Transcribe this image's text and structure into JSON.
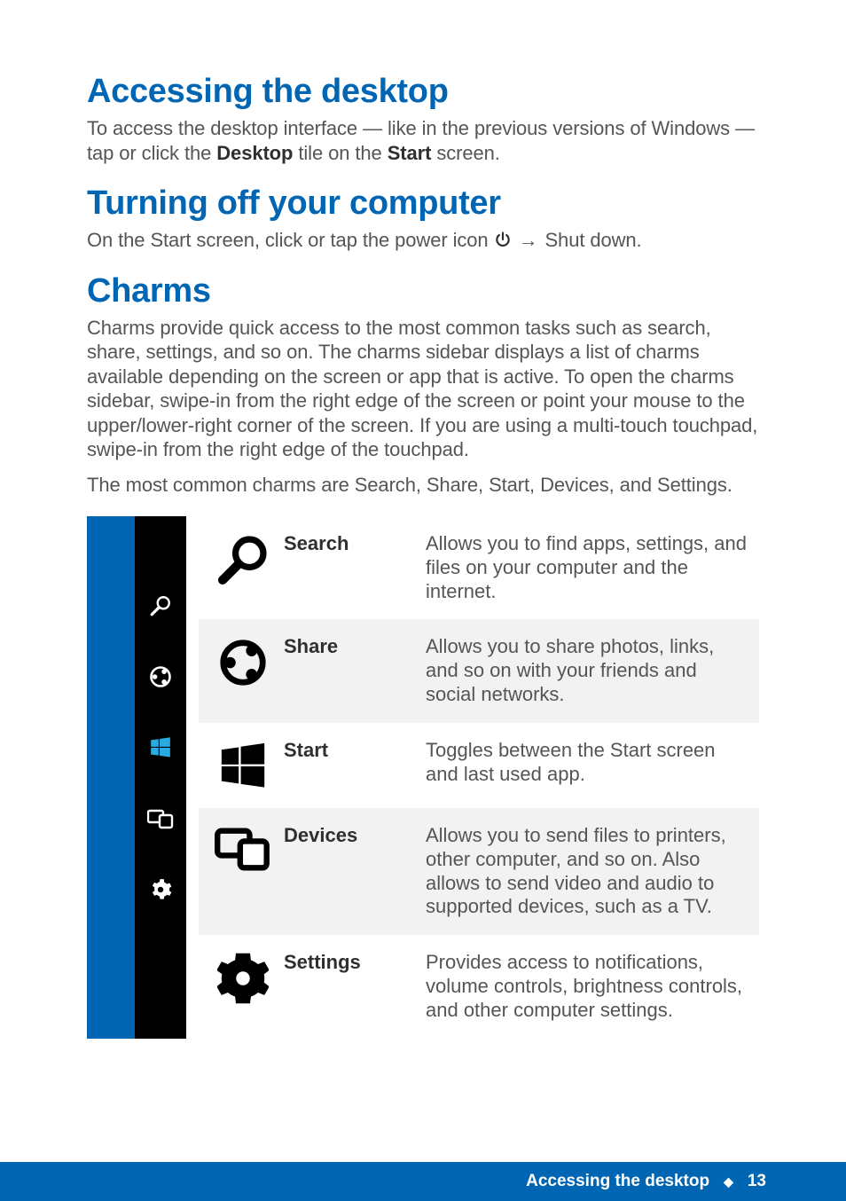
{
  "sections": {
    "accessing": {
      "heading": "Accessing the desktop",
      "body_pre": "To access the desktop interface — like in the previous versions of Windows — tap or click the ",
      "body_bold1": "Desktop",
      "body_mid": " tile on the ",
      "body_bold2": "Start",
      "body_post": " screen."
    },
    "turning_off": {
      "heading": "Turning off your computer",
      "body_pre": "On the Start screen, click or tap the power icon ",
      "arrow": "→",
      "body_post": " Shut down."
    },
    "charms": {
      "heading": "Charms",
      "body1": "Charms provide quick access to the most common tasks such as search, share, settings, and so on. The charms sidebar displays a list of charms available depending on the screen or app that is active. To open the charms sidebar, swipe-in from the right edge of the screen or point your mouse to the upper/lower-right corner of the screen. If you are using a multi-touch touchpad, swipe-in from the right edge of the touchpad.",
      "body2": "The most common charms are Search, Share, Start, Devices, and Settings."
    }
  },
  "charms_list": [
    {
      "name": "Search",
      "desc": "Allows you to find apps, settings, and files on your computer and the internet."
    },
    {
      "name": "Share",
      "desc": "Allows you to share photos, links, and so on with your friends and social networks."
    },
    {
      "name": "Start",
      "desc": "Toggles between the Start screen and last used app."
    },
    {
      "name": "Devices",
      "desc": "Allows you to send files to printers, other computer, and so on. Also allows to send video and audio to supported devices, such as a TV."
    },
    {
      "name": "Settings",
      "desc": "Provides access to notifications, volume controls, brightness controls, and other computer settings."
    }
  ],
  "footer": {
    "title": "Accessing the desktop",
    "page": "13"
  }
}
